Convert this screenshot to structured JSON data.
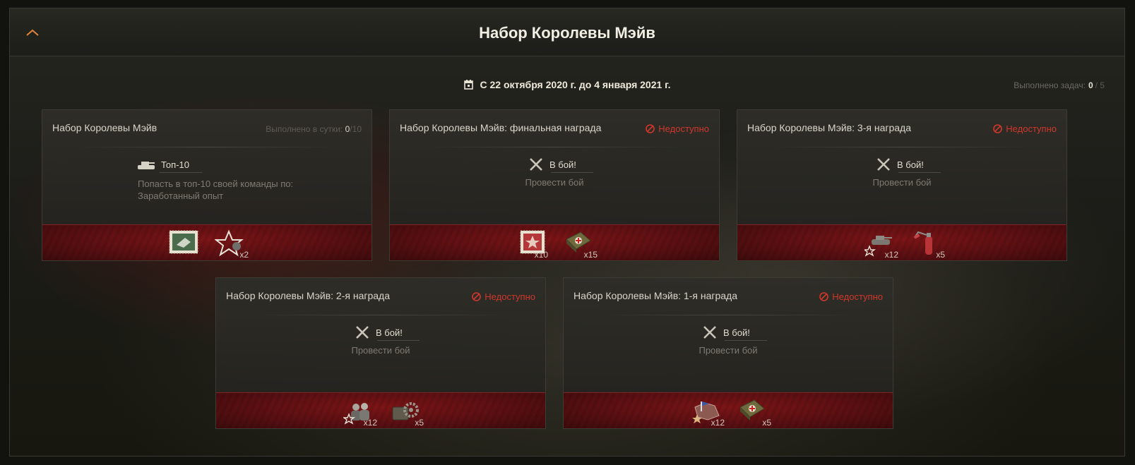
{
  "page": {
    "title": "Набор Королевы Мэйв",
    "dates": "С 22 октября 2020 г. до 4 января 2021 г.",
    "progress": {
      "label": "Выполнено задач:",
      "done": "0",
      "sep": "/",
      "total": "5"
    }
  },
  "cards": [
    {
      "title": "Набор Королевы Мэйв",
      "stat_label": "Выполнено в сутки:",
      "stat_done": "0",
      "stat_sep": "/",
      "stat_total": "10",
      "task_icon": "tank-icon",
      "task_name": "Топ-10",
      "task_desc_1": "Попасть в топ-10 своей команды по:",
      "task_desc_2": "Заработанный опыт",
      "rewards": [
        {
          "icon": "stamp-icon",
          "count": ""
        },
        {
          "icon": "star-crew-icon",
          "count": "x2"
        }
      ]
    },
    {
      "title": "Набор Королевы Мэйв: финальная награда",
      "status": "Недоступно",
      "task_icon": "crossed-swords-icon",
      "task_name": "В бой!",
      "task_desc_1": "Провести бой",
      "rewards": [
        {
          "icon": "red-stamp-icon",
          "count": "x10"
        },
        {
          "icon": "medkit-icon",
          "count": "x15"
        }
      ]
    },
    {
      "title": "Набор Королевы Мэйв: 3-я награда",
      "status": "Недоступно",
      "task_icon": "crossed-swords-icon",
      "task_name": "В бой!",
      "task_desc_1": "Провести бой",
      "rewards": [
        {
          "icon": "tank-star-icon",
          "count": "x12"
        },
        {
          "icon": "fire-extinguisher-icon",
          "count": "x5"
        }
      ]
    },
    {
      "title": "Набор Королевы Мэйв: 2-я награда",
      "status": "Недоступно",
      "task_icon": "crossed-swords-icon",
      "task_name": "В бой!",
      "task_desc_1": "Провести бой",
      "rewards": [
        {
          "icon": "crew-star-icon",
          "count": "x12"
        },
        {
          "icon": "repair-kit-icon",
          "count": "x5"
        }
      ]
    },
    {
      "title": "Набор Королевы Мэйв: 1-я награда",
      "status": "Недоступно",
      "task_icon": "crossed-swords-icon",
      "task_name": "В бой!",
      "task_desc_1": "Провести бой",
      "rewards": [
        {
          "icon": "map-star-icon",
          "count": "x12"
        },
        {
          "icon": "medkit-icon",
          "count": "x5"
        }
      ]
    }
  ],
  "colors": {
    "accent_red": "#d0372c",
    "reward_band": "#7b1416",
    "text_light": "#eeeadc"
  }
}
